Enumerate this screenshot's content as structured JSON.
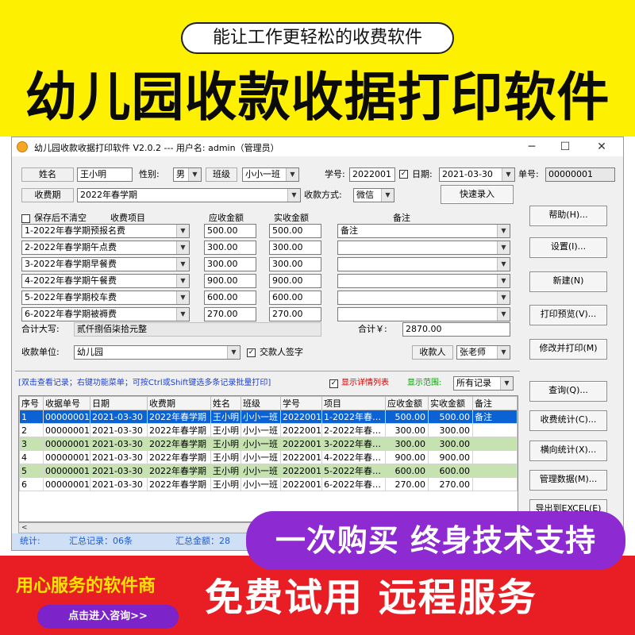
{
  "banner": {
    "slogan": "能让工作更轻松的收费软件",
    "title": "幼儿园收款收据打印软件"
  },
  "window": {
    "title": "幼儿园收款收据打印软件 V2.0.2 --- 用户名: admin（管理员）",
    "minimize": "─",
    "maximize": "☐",
    "close": "✕"
  },
  "form": {
    "name_label": "姓名",
    "name_value": "王小明",
    "gender_label": "性别:",
    "gender_value": "男",
    "class_label": "班级",
    "class_value": "小小一班",
    "student_no_label": "学号:",
    "student_no_value": "2022001",
    "date_label": "日期:",
    "date_value": "2021-03-30",
    "receipt_no_label": "单号:",
    "receipt_no_value": "00000001",
    "period_label": "收费期",
    "period_value": "2022年春学期",
    "pay_method_label": "收款方式:",
    "pay_method_value": "微信",
    "quick_entry": "快速录入",
    "keep_label": "保存后不清空",
    "col_item": "收费项目",
    "col_due": "应收金额",
    "col_paid": "实收金额",
    "col_remark": "备注",
    "items": [
      {
        "item": "1-2022年春学期预报名费",
        "due": "500.00",
        "paid": "500.00",
        "remark": "备注"
      },
      {
        "item": "2-2022年春学期午点费",
        "due": "300.00",
        "paid": "300.00",
        "remark": ""
      },
      {
        "item": "3-2022年春学期早餐费",
        "due": "300.00",
        "paid": "300.00",
        "remark": ""
      },
      {
        "item": "4-2022年春学期午餐费",
        "due": "900.00",
        "paid": "900.00",
        "remark": ""
      },
      {
        "item": "5-2022年春学期校车费",
        "due": "600.00",
        "paid": "600.00",
        "remark": ""
      },
      {
        "item": "6-2022年春学期被褥费",
        "due": "270.00",
        "paid": "270.00",
        "remark": ""
      }
    ],
    "total_upper_label": "合计大写:",
    "total_upper_value": "贰仟捌佰柒拾元整",
    "total_label": "合计￥:",
    "total_value": "2870.00",
    "unit_label": "收款单位:",
    "unit_value": "幼儿园",
    "sign_label": "交款人签字",
    "payee_label": "收款人",
    "payee_value": "张老师"
  },
  "side_buttons": {
    "help": "帮助(H)...",
    "settings": "设置(I)...",
    "new": "新建(N)",
    "print_preview": "打印预览(V)...",
    "modify_print": "修改并打印(M)",
    "query": "查询(Q)...",
    "fee_stats": "收费统计(C)...",
    "cross_stats": "横向统计(X)...",
    "manage_data": "管理数据(M)...",
    "export_excel": "导出到EXCEL(E)"
  },
  "records": {
    "hint": "[双击查看记录；右键功能菜单；可按Ctrl或Shift键选多条记录批量打印]",
    "show_detail": "显示详情列表",
    "range_label": "显示范围:",
    "range_value": "所有记录",
    "headers": [
      "序号",
      "收据单号",
      "日期",
      "收费期",
      "姓名",
      "班级",
      "学号",
      "项目",
      "应收金额",
      "实收金额",
      "备注"
    ],
    "rows": [
      [
        "1",
        "00000001",
        "2021-03-30",
        "2022年春学期",
        "王小明",
        "小小一班",
        "2022001",
        "1-2022年春…",
        "500.00",
        "500.00",
        "备注"
      ],
      [
        "2",
        "00000001",
        "2021-03-30",
        "2022年春学期",
        "王小明",
        "小小一班",
        "2022001",
        "2-2022年春…",
        "300.00",
        "300.00",
        ""
      ],
      [
        "3",
        "00000001",
        "2021-03-30",
        "2022年春学期",
        "王小明",
        "小小一班",
        "2022001",
        "3-2022年春…",
        "300.00",
        "300.00",
        ""
      ],
      [
        "4",
        "00000001",
        "2021-03-30",
        "2022年春学期",
        "王小明",
        "小小一班",
        "2022001",
        "4-2022年春…",
        "900.00",
        "900.00",
        ""
      ],
      [
        "5",
        "00000001",
        "2021-03-30",
        "2022年春学期",
        "王小明",
        "小小一班",
        "2022001",
        "5-2022年春…",
        "600.00",
        "600.00",
        ""
      ],
      [
        "6",
        "00000001",
        "2021-03-30",
        "2022年春学期",
        "王小明",
        "小小一班",
        "2022001",
        "6-2022年春…",
        "270.00",
        "270.00",
        ""
      ]
    ],
    "scroll_left": "<"
  },
  "status": {
    "label": "统计:",
    "count": "汇总记录：06条",
    "amount": "汇总金额：28"
  },
  "promo": {
    "lifetime": "一次购买 终身技术支持",
    "service_vendor": "用心服务的软件商",
    "consult": "点击进入咨询>>",
    "trial": "免费试用 远程服务"
  },
  "colors": {
    "banner_yellow": "#fdf000",
    "selected_row": "#0a62d4",
    "alt_row": "#c6e2b0",
    "promo_purple": "#8d2ad1",
    "bottom_red": "#e91d24",
    "hint_blue": "#1d3fd1",
    "detail_red": "#d00000",
    "range_green": "#00a000"
  }
}
